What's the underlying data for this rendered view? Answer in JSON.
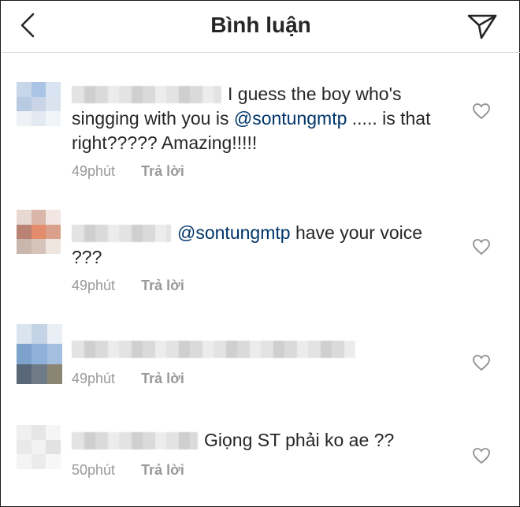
{
  "header": {
    "title": "Bình luận",
    "back_icon": "chevron-left-icon",
    "send_icon": "paper-plane-icon"
  },
  "comments": [
    {
      "text": "I guess the boy who's singging with you is",
      "mention": "@sontungmtp",
      "text_after": "..... is that right????? Amazing!!!!!",
      "time": "49phút",
      "reply": "Trả lời"
    },
    {
      "text": "",
      "mention": "@sontungmtp",
      "text_after": "have your voice ???",
      "time": "49phút",
      "reply": "Trả lời"
    },
    {
      "text": "",
      "mention": "",
      "text_after": "",
      "time": "49phút",
      "reply": "Trả lời"
    },
    {
      "text": "Giọng ST phải ko ae ??",
      "mention": "",
      "text_after": "",
      "time": "50phút",
      "reply": "Trả lời"
    }
  ],
  "colors": {
    "mention": "#003569",
    "meta": "#999999",
    "divider": "#dbdbdb"
  }
}
